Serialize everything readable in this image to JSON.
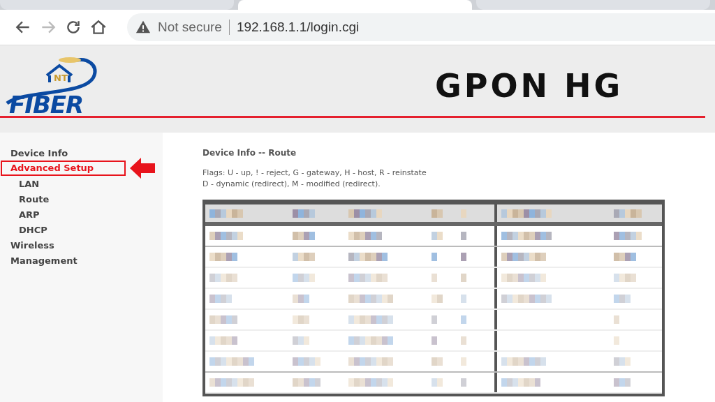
{
  "browser": {
    "tabs": [
      {
        "selected": false
      },
      {
        "selected": true
      },
      {
        "selected": false
      }
    ],
    "security": "Not secure",
    "url": "192.168.1.1/login.cgi"
  },
  "banner": {
    "logo_mark": "NT",
    "logo_name": "FIBER",
    "title": "GPON HG"
  },
  "sidebar": {
    "items": [
      {
        "label": "Device Info",
        "selected": false,
        "annotated": false
      },
      {
        "label": "Advanced Setup",
        "selected": true,
        "annotated": true,
        "children": [
          {
            "label": "LAN",
            "selected": false,
            "annotated": false
          },
          {
            "label": "Route",
            "selected": false,
            "annotated": false
          },
          {
            "label": "ARP",
            "selected": false,
            "annotated": false
          },
          {
            "label": "DHCP",
            "selected": false,
            "annotated": false
          }
        ]
      },
      {
        "label": "Wireless",
        "selected": false,
        "annotated": false
      },
      {
        "label": "Management",
        "selected": false,
        "annotated": false
      }
    ]
  },
  "content": {
    "heading": "Device Info -- Route",
    "flags": [
      "Flags: U - up, ! - reject, G - gateway, H - host, R - reinstate",
      "D - dynamic (redirect), M - modified (redirect)."
    ],
    "table": {
      "kind": "pixelated"
    }
  }
}
